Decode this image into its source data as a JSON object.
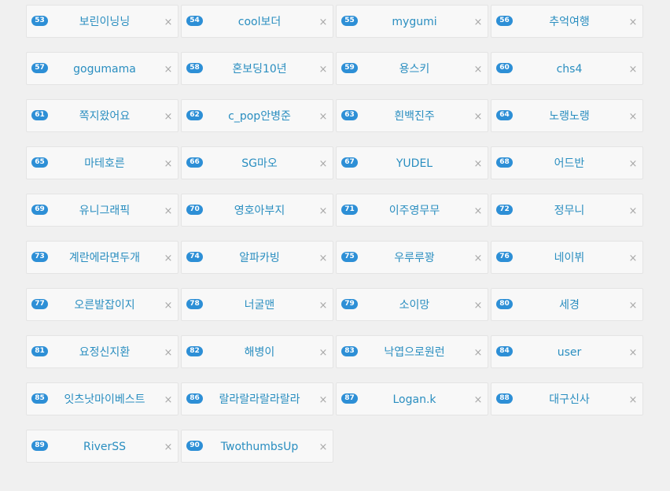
{
  "close_glyph": "×",
  "chips": [
    {
      "num": "53",
      "name": "보린이닝닝"
    },
    {
      "num": "54",
      "name": "cool보더"
    },
    {
      "num": "55",
      "name": "mygumi"
    },
    {
      "num": "56",
      "name": "추억여행"
    },
    {
      "num": "57",
      "name": "gogumama"
    },
    {
      "num": "58",
      "name": "혼보딩10년"
    },
    {
      "num": "59",
      "name": "용스키"
    },
    {
      "num": "60",
      "name": "chs4"
    },
    {
      "num": "61",
      "name": "쪽지왔어요"
    },
    {
      "num": "62",
      "name": "c_pop안병준"
    },
    {
      "num": "63",
      "name": "흰백진주"
    },
    {
      "num": "64",
      "name": "노랭노랭"
    },
    {
      "num": "65",
      "name": "마테호른"
    },
    {
      "num": "66",
      "name": "SG마오"
    },
    {
      "num": "67",
      "name": "YUDEL"
    },
    {
      "num": "68",
      "name": "어드반"
    },
    {
      "num": "69",
      "name": "유니그래픽"
    },
    {
      "num": "70",
      "name": "영호아부지"
    },
    {
      "num": "71",
      "name": "이주영무무"
    },
    {
      "num": "72",
      "name": "정무니"
    },
    {
      "num": "73",
      "name": "계란에라면두개"
    },
    {
      "num": "74",
      "name": "알파카빙"
    },
    {
      "num": "75",
      "name": "우루루꽝"
    },
    {
      "num": "76",
      "name": "네이뷔"
    },
    {
      "num": "77",
      "name": "오른발잡이지"
    },
    {
      "num": "78",
      "name": "너굴맨"
    },
    {
      "num": "79",
      "name": "소이망"
    },
    {
      "num": "80",
      "name": "세경"
    },
    {
      "num": "81",
      "name": "요정신지환"
    },
    {
      "num": "82",
      "name": "해병이"
    },
    {
      "num": "83",
      "name": "낙엽으로원런"
    },
    {
      "num": "84",
      "name": "user"
    },
    {
      "num": "85",
      "name": "잇츠낫마이베스트"
    },
    {
      "num": "86",
      "name": "랄라랄라랄라랄라"
    },
    {
      "num": "87",
      "name": "Logan.k"
    },
    {
      "num": "88",
      "name": "대구신사"
    },
    {
      "num": "89",
      "name": "RiverSS"
    },
    {
      "num": "90",
      "name": "TwothumbsUp"
    }
  ]
}
